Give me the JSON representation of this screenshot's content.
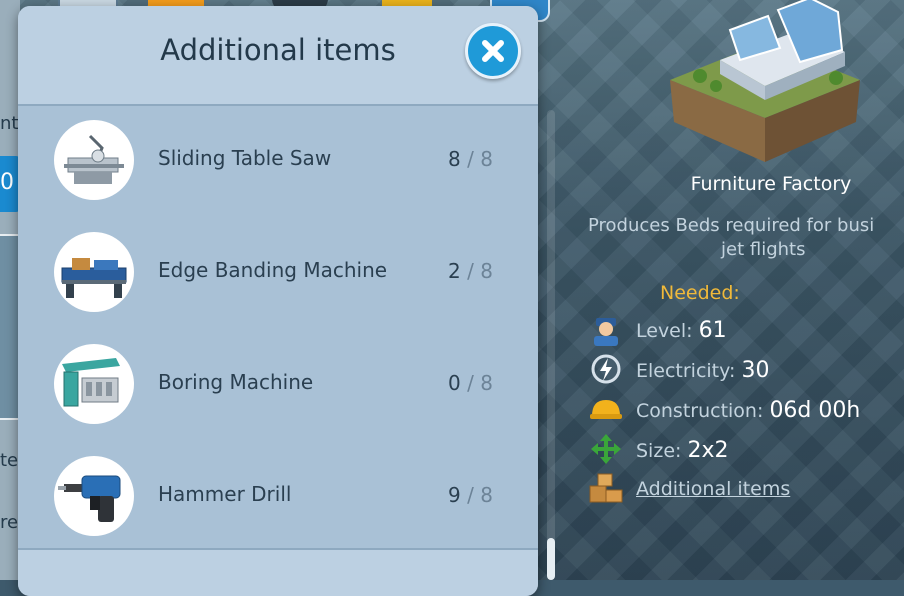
{
  "modal": {
    "title": "Additional items",
    "items": [
      {
        "name": "Sliding Table Saw",
        "have": "8",
        "sep": "/",
        "need": "8"
      },
      {
        "name": "Edge Banding Machine",
        "have": "2",
        "sep": "/",
        "need": "8"
      },
      {
        "name": "Boring Machine",
        "have": "0",
        "sep": "/",
        "need": "8"
      },
      {
        "name": "Hammer Drill",
        "have": "9",
        "sep": "/",
        "need": "8"
      }
    ]
  },
  "left_partial": {
    "blue_value": "0",
    "text_1": "nt",
    "text_2": "te",
    "text_3": "re"
  },
  "building": {
    "name": "Furniture Factory",
    "description_1": "Produces Beds required for busi",
    "description_2": "jet flights",
    "needed_label": "Needed:",
    "level_label": "Level:",
    "level_value": "61",
    "electricity_label": "Electricity:",
    "electricity_value": "30",
    "construction_label": "Construction:",
    "construction_value": "06d 00h",
    "size_label": "Size:",
    "size_value": "2x2",
    "additional_items_link": "Additional items"
  },
  "colors": {
    "accent_blue": "#1f9ad8",
    "needed_gold": "#f0b93a",
    "modal_bg": "#a9c1d6"
  }
}
